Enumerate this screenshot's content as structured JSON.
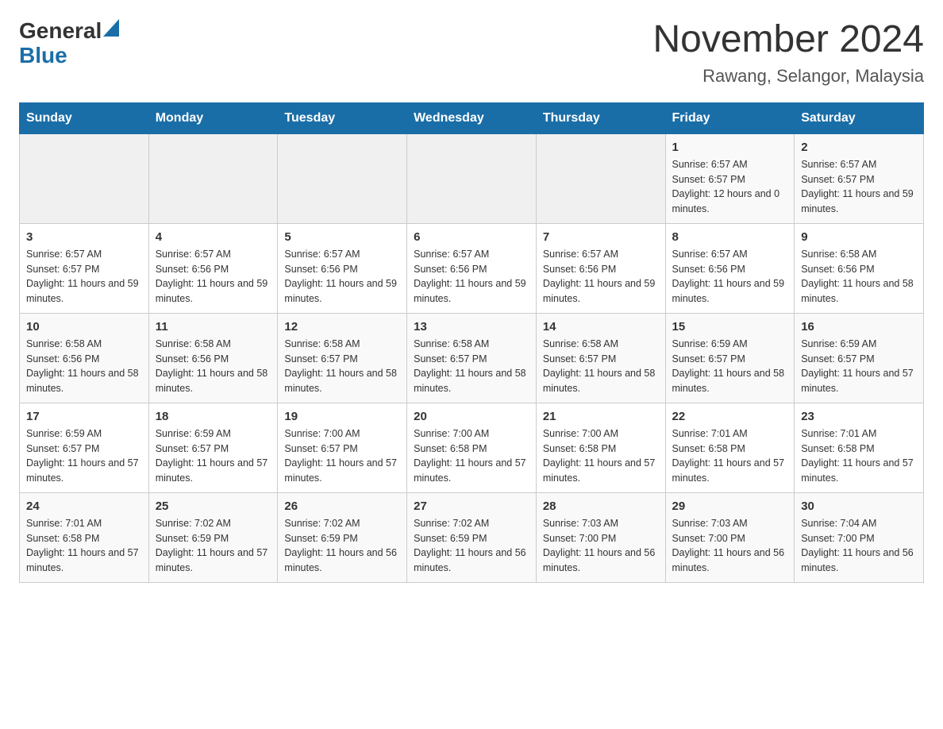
{
  "header": {
    "logo": {
      "general": "General",
      "blue": "Blue"
    },
    "month_title": "November 2024",
    "location": "Rawang, Selangor, Malaysia"
  },
  "days_of_week": [
    "Sunday",
    "Monday",
    "Tuesday",
    "Wednesday",
    "Thursday",
    "Friday",
    "Saturday"
  ],
  "weeks": [
    [
      {
        "day": "",
        "info": ""
      },
      {
        "day": "",
        "info": ""
      },
      {
        "day": "",
        "info": ""
      },
      {
        "day": "",
        "info": ""
      },
      {
        "day": "",
        "info": ""
      },
      {
        "day": "1",
        "info": "Sunrise: 6:57 AM\nSunset: 6:57 PM\nDaylight: 12 hours and 0 minutes."
      },
      {
        "day": "2",
        "info": "Sunrise: 6:57 AM\nSunset: 6:57 PM\nDaylight: 11 hours and 59 minutes."
      }
    ],
    [
      {
        "day": "3",
        "info": "Sunrise: 6:57 AM\nSunset: 6:57 PM\nDaylight: 11 hours and 59 minutes."
      },
      {
        "day": "4",
        "info": "Sunrise: 6:57 AM\nSunset: 6:56 PM\nDaylight: 11 hours and 59 minutes."
      },
      {
        "day": "5",
        "info": "Sunrise: 6:57 AM\nSunset: 6:56 PM\nDaylight: 11 hours and 59 minutes."
      },
      {
        "day": "6",
        "info": "Sunrise: 6:57 AM\nSunset: 6:56 PM\nDaylight: 11 hours and 59 minutes."
      },
      {
        "day": "7",
        "info": "Sunrise: 6:57 AM\nSunset: 6:56 PM\nDaylight: 11 hours and 59 minutes."
      },
      {
        "day": "8",
        "info": "Sunrise: 6:57 AM\nSunset: 6:56 PM\nDaylight: 11 hours and 59 minutes."
      },
      {
        "day": "9",
        "info": "Sunrise: 6:58 AM\nSunset: 6:56 PM\nDaylight: 11 hours and 58 minutes."
      }
    ],
    [
      {
        "day": "10",
        "info": "Sunrise: 6:58 AM\nSunset: 6:56 PM\nDaylight: 11 hours and 58 minutes."
      },
      {
        "day": "11",
        "info": "Sunrise: 6:58 AM\nSunset: 6:56 PM\nDaylight: 11 hours and 58 minutes."
      },
      {
        "day": "12",
        "info": "Sunrise: 6:58 AM\nSunset: 6:57 PM\nDaylight: 11 hours and 58 minutes."
      },
      {
        "day": "13",
        "info": "Sunrise: 6:58 AM\nSunset: 6:57 PM\nDaylight: 11 hours and 58 minutes."
      },
      {
        "day": "14",
        "info": "Sunrise: 6:58 AM\nSunset: 6:57 PM\nDaylight: 11 hours and 58 minutes."
      },
      {
        "day": "15",
        "info": "Sunrise: 6:59 AM\nSunset: 6:57 PM\nDaylight: 11 hours and 58 minutes."
      },
      {
        "day": "16",
        "info": "Sunrise: 6:59 AM\nSunset: 6:57 PM\nDaylight: 11 hours and 57 minutes."
      }
    ],
    [
      {
        "day": "17",
        "info": "Sunrise: 6:59 AM\nSunset: 6:57 PM\nDaylight: 11 hours and 57 minutes."
      },
      {
        "day": "18",
        "info": "Sunrise: 6:59 AM\nSunset: 6:57 PM\nDaylight: 11 hours and 57 minutes."
      },
      {
        "day": "19",
        "info": "Sunrise: 7:00 AM\nSunset: 6:57 PM\nDaylight: 11 hours and 57 minutes."
      },
      {
        "day": "20",
        "info": "Sunrise: 7:00 AM\nSunset: 6:58 PM\nDaylight: 11 hours and 57 minutes."
      },
      {
        "day": "21",
        "info": "Sunrise: 7:00 AM\nSunset: 6:58 PM\nDaylight: 11 hours and 57 minutes."
      },
      {
        "day": "22",
        "info": "Sunrise: 7:01 AM\nSunset: 6:58 PM\nDaylight: 11 hours and 57 minutes."
      },
      {
        "day": "23",
        "info": "Sunrise: 7:01 AM\nSunset: 6:58 PM\nDaylight: 11 hours and 57 minutes."
      }
    ],
    [
      {
        "day": "24",
        "info": "Sunrise: 7:01 AM\nSunset: 6:58 PM\nDaylight: 11 hours and 57 minutes."
      },
      {
        "day": "25",
        "info": "Sunrise: 7:02 AM\nSunset: 6:59 PM\nDaylight: 11 hours and 57 minutes."
      },
      {
        "day": "26",
        "info": "Sunrise: 7:02 AM\nSunset: 6:59 PM\nDaylight: 11 hours and 56 minutes."
      },
      {
        "day": "27",
        "info": "Sunrise: 7:02 AM\nSunset: 6:59 PM\nDaylight: 11 hours and 56 minutes."
      },
      {
        "day": "28",
        "info": "Sunrise: 7:03 AM\nSunset: 7:00 PM\nDaylight: 11 hours and 56 minutes."
      },
      {
        "day": "29",
        "info": "Sunrise: 7:03 AM\nSunset: 7:00 PM\nDaylight: 11 hours and 56 minutes."
      },
      {
        "day": "30",
        "info": "Sunrise: 7:04 AM\nSunset: 7:00 PM\nDaylight: 11 hours and 56 minutes."
      }
    ]
  ]
}
